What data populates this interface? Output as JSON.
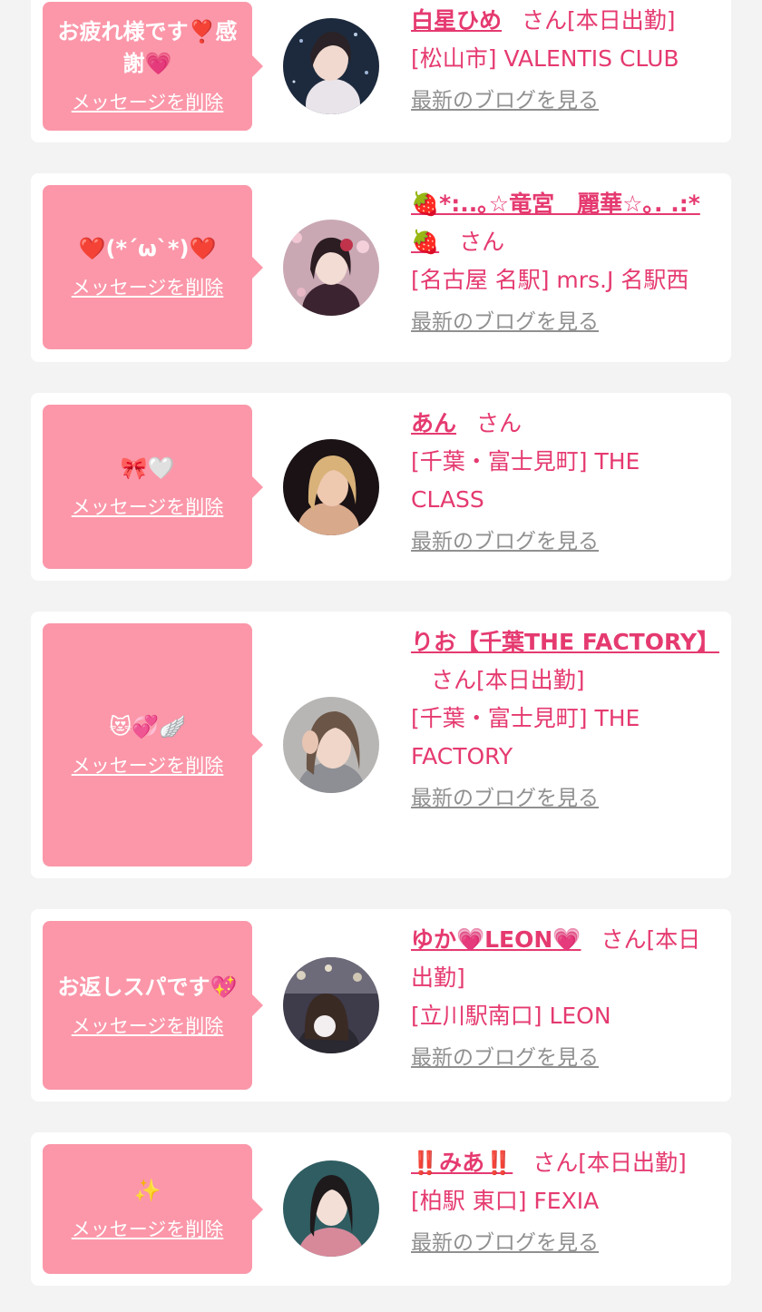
{
  "delete_label": "メッセージを削除",
  "blog_label": "最新のブログを見る",
  "san_label": "さん",
  "colors": {
    "background": "#f3f3f3",
    "card": "#ffffff",
    "bubble": "#fb97a9",
    "accent": "#e53a70",
    "link_gray": "#909090"
  },
  "entries": [
    {
      "message": "お疲れ様です❣️感謝💗",
      "name": "白星ひめ",
      "status": "[本日出勤]",
      "shop": "[松山市] VALENTIS CLUB",
      "avatar_icon": "girl-photo-avatar-icon"
    },
    {
      "message": "❤️(*´ω`*)❤️",
      "name": "🍓*:..｡☆竜宮　麗華☆｡. .:*🍓",
      "status": "",
      "shop": "[名古屋 名駅] mrs.J 名駅西",
      "avatar_icon": "girl-photo-avatar-icon"
    },
    {
      "message": "🎀🤍",
      "name": "あん",
      "status": "",
      "shop": "[千葉・富士見町] THE CLASS",
      "avatar_icon": "girl-photo-avatar-icon"
    },
    {
      "message": "😻💞🪽",
      "name": "りお【千葉THE FACTORY】",
      "status": "[本日出勤]",
      "shop": "[千葉・富士見町] THE FACTORY",
      "avatar_icon": "girl-photo-avatar-icon"
    },
    {
      "message": "お返しスパです💖",
      "name": "ゆか💗LEON💗",
      "status": "[本日出勤]",
      "shop": "[立川駅南口] LEON",
      "avatar_icon": "girl-photo-avatar-icon"
    },
    {
      "message": "✨",
      "name": "‼️みあ‼️",
      "status": "[本日出勤]",
      "shop": "[柏駅 東口] FEXIA",
      "avatar_icon": "girl-photo-avatar-icon"
    }
  ]
}
